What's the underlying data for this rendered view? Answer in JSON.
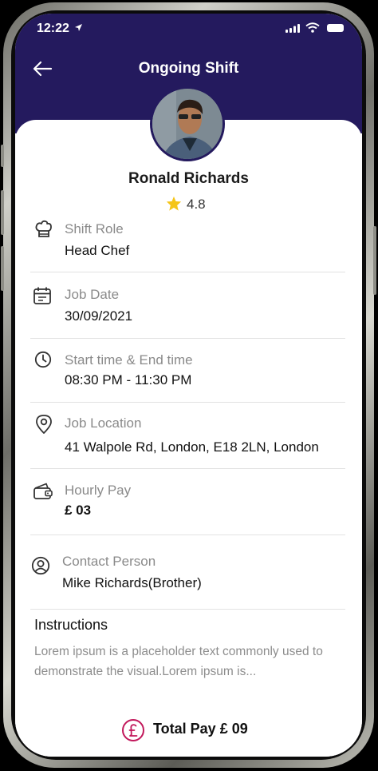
{
  "status_bar": {
    "time": "12:22"
  },
  "header": {
    "title": "Ongoing Shift",
    "background_color": "#241a5e"
  },
  "profile": {
    "name": "Ronald Richards",
    "rating": "4.8"
  },
  "fields": {
    "shift_role": {
      "label": "Shift Role",
      "value": "Head Chef",
      "icon": "chef-hat-icon"
    },
    "job_date": {
      "label": "Job Date",
      "value": "30/09/2021",
      "icon": "calendar-icon"
    },
    "time": {
      "label": "Start time & End time",
      "value": "08:30 PM - 11:30 PM",
      "icon": "clock-icon"
    },
    "location": {
      "label": "Job Location",
      "value": "41 Walpole Rd, London, E18 2LN, London",
      "icon": "location-pin-icon"
    },
    "hourly_pay": {
      "label": "Hourly Pay",
      "value": "£ 03",
      "icon": "wallet-icon"
    },
    "contact": {
      "label": "Contact Person",
      "value": "Mike Richards(Brother)",
      "icon": "user-circle-icon"
    }
  },
  "instructions": {
    "title": "Instructions",
    "text": "Lorem ipsum is a placeholder text commonly used to demonstrate the visual.Lorem ipsum is..."
  },
  "total_pay": {
    "label": "Total Pay £ 09",
    "icon": "pound-coin-icon",
    "accent_color": "#c2185b"
  }
}
